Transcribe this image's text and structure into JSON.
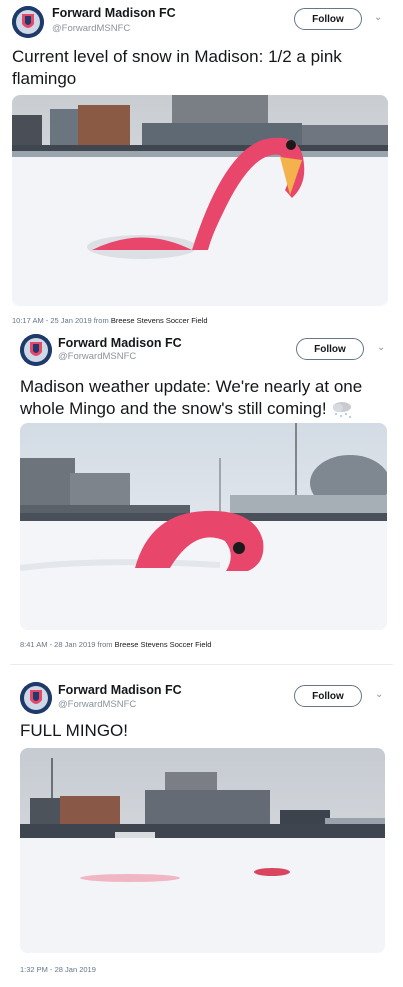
{
  "tweets": [
    {
      "name": "Forward Madison FC",
      "handle": "@ForwardMSNFC",
      "follow_label": "Follow",
      "text": "Current level of snow in Madison: 1/2 a pink flamingo",
      "meta_time": "10:17 AM - 25 Jan 2019 from",
      "meta_place": "Breese Stevens Soccer Field"
    },
    {
      "name": "Forward Madison FC",
      "handle": "@ForwardMSNFC",
      "follow_label": "Follow",
      "text": "Madison weather update: We're nearly at one whole Mingo and the snow's still coming!",
      "meta_time": "8:41 AM - 28 Jan 2019 from",
      "meta_place": "Breese Stevens Soccer Field"
    },
    {
      "name": "Forward Madison FC",
      "handle": "@ForwardMSNFC",
      "follow_label": "Follow",
      "text": "FULL MINGO!",
      "meta_time": "1:32 PM - 28 Jan 2019",
      "meta_place": ""
    }
  ],
  "icons": {
    "more": "chevron-down-icon",
    "snow_emoji": "cloud-snow-icon"
  },
  "colors": {
    "flamingo": "#e8476b",
    "snow": "#f4f6f9",
    "sky": "#dfe3e8",
    "text_secondary": "#657786"
  }
}
